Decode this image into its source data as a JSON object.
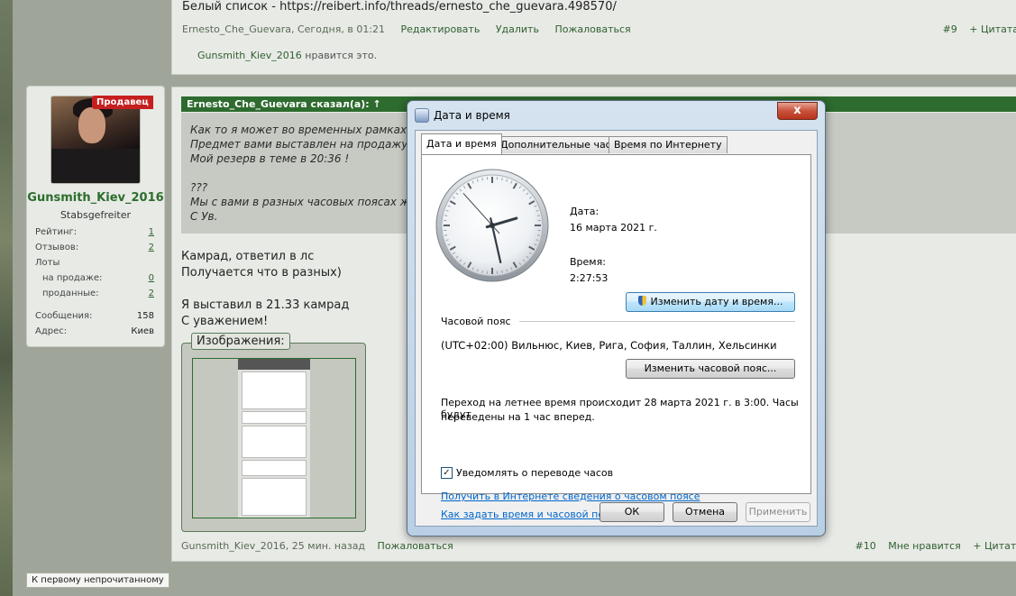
{
  "top_post": {
    "whitelist_text": "Белый список - https://reibert.info/threads/ernesto_che_guevara.498570/",
    "meta": "Ernesto_Che_Guevara, Сегодня, в 01:21",
    "edit": "Редактировать",
    "delete": "Удалить",
    "report": "Пожаловаться",
    "post_number": "#9",
    "quote": "+ Цитата",
    "likes_user": "Gunsmith_Kiev_2016",
    "likes_suffix": " нравится это."
  },
  "user_card": {
    "badge": "Продавец",
    "username": "Gunsmith_Kiev_2016",
    "rank": "Stabsgefreiter",
    "stats": [
      {
        "label": "Рейтинг:",
        "value": "1"
      },
      {
        "label": "Отзывов:",
        "value": "2"
      },
      {
        "label": "Лоты",
        "value": ""
      },
      {
        "label": "на продаже:",
        "value": "0"
      },
      {
        "label": "проданные:",
        "value": "2"
      },
      {
        "label": "Сообщения:",
        "value": "158"
      },
      {
        "label": "Адрес:",
        "value": "Киев"
      }
    ]
  },
  "main_post": {
    "quote_header": "Ernesto_Che_Guevara сказал(а): ↑",
    "quote_lines": [
      "Как то я может во временных рамках",
      "Предмет вами выставлен на продажу",
      "Мой резерв в теме в 20:36 !",
      "",
      "???",
      "Мы с вами в разных часовых поясах ж",
      "С Ув."
    ],
    "text_lines": [
      "Камрад, ответил в лс",
      "Получается что в разных)",
      "",
      "Я выставил в 21.33 камрад",
      "С уважением!"
    ],
    "images_label": "Изображения:",
    "meta": "Gunsmith_Kiev_2016, 25 мин. назад",
    "report": "Пожаловаться",
    "post_number": "#10",
    "like": "Мне нравится",
    "quote": "+ Цитата"
  },
  "unread_button": "К первому непрочитанному",
  "dialog": {
    "title": "Дата и время",
    "close": "x",
    "tabs": [
      "Дата и время",
      "Дополнительные часы",
      "Время по Интернету"
    ],
    "date_label": "Дата:",
    "date_value": "16 марта 2021 г.",
    "time_label": "Время:",
    "time_value": "2:27:53",
    "change_datetime": "Изменить дату и время...",
    "timezone_label": "Часовой пояс",
    "timezone_value": "(UTC+02:00) Вильнюс, Киев, Рига, София, Таллин, Хельсинки",
    "change_timezone": "Изменить часовой пояс...",
    "dst_line1": "Переход на летнее время происходит 28 марта 2021 г. в 3:00. Часы будут",
    "dst_line2": "переведены на 1 час вперед.",
    "notify_label": "Уведомлять о переводе часов",
    "notify_checked": true,
    "link_info": "Получить в Интернете сведения о часовом поясе",
    "link_howto": "Как задать время и часовой пояс?",
    "ok": "ОК",
    "cancel": "Отмена",
    "apply": "Применить",
    "clock": {
      "hours": 2,
      "minutes": 27,
      "seconds": 53
    }
  },
  "colors": {
    "accent_green": "#2e6b2e",
    "badge_red": "#c61f1f",
    "link_blue": "#0066cc"
  }
}
